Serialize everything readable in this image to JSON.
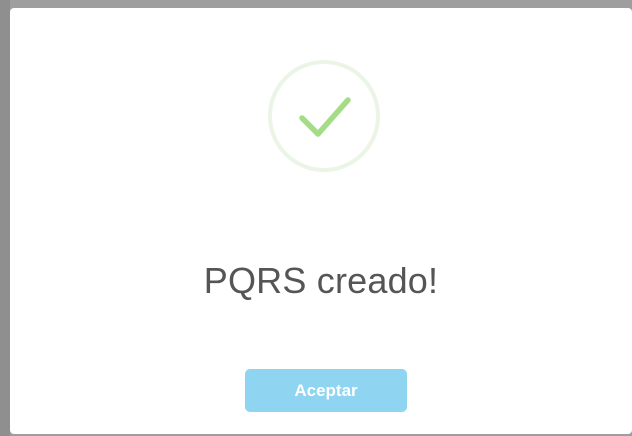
{
  "dialog": {
    "icon": "success-check-icon",
    "title": "PQRS creado!",
    "confirm_button_label": "Aceptar"
  },
  "colors": {
    "check_stroke": "#a5dc86",
    "circle_border": "#eaf5e6",
    "button_bg": "#8fd4f1",
    "title_text": "#555555"
  }
}
